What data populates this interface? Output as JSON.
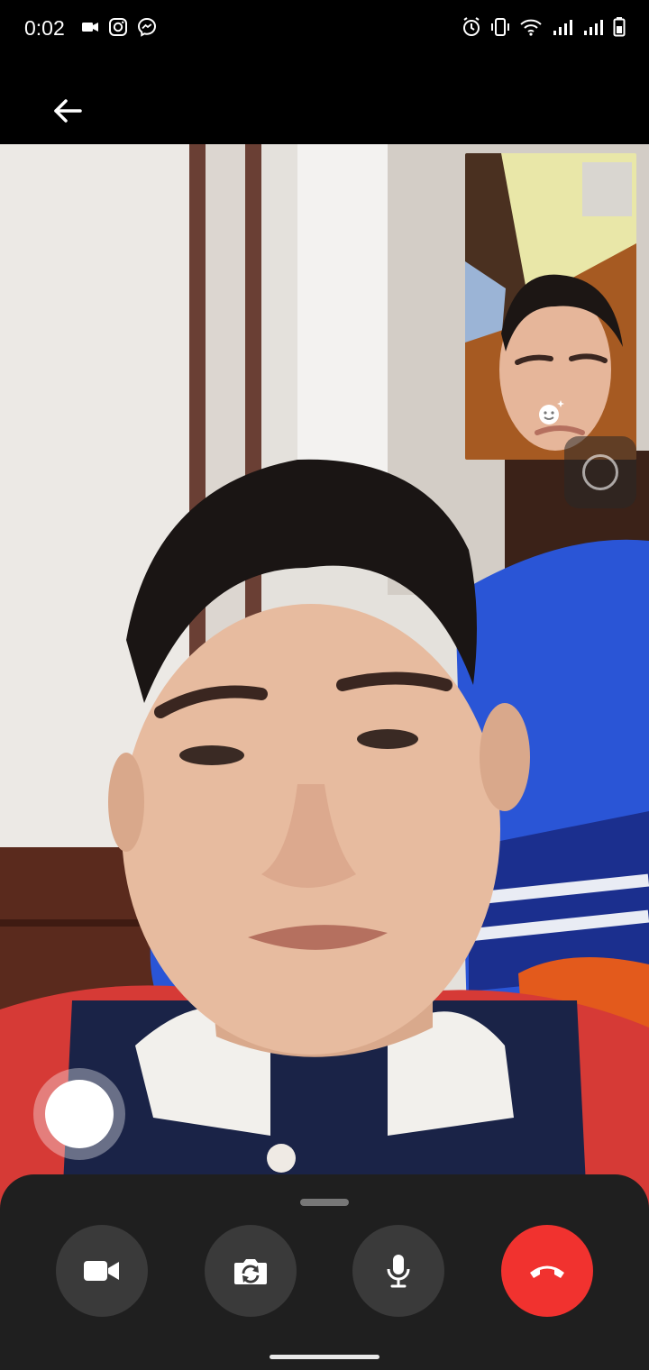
{
  "status_bar": {
    "time": "0:02",
    "left_icons": [
      "video-camera-icon",
      "instagram-icon",
      "messenger-icon"
    ],
    "right_icons": [
      "alarm-icon",
      "vibrate-icon",
      "wifi-icon",
      "signal-icon",
      "signal-icon",
      "battery-icon"
    ]
  },
  "header": {
    "back_icon": "back-arrow-icon"
  },
  "call": {
    "remote_video": "remote-participant-video",
    "self_preview": "self-camera-preview",
    "effects_icon": "effects-smiley-icon"
  },
  "controls": {
    "buttons": [
      {
        "name": "video-toggle",
        "icon": "video-camera-icon"
      },
      {
        "name": "flip-camera",
        "icon": "flip-camera-icon"
      },
      {
        "name": "mute-microphone",
        "icon": "microphone-icon"
      },
      {
        "name": "end-call",
        "icon": "hang-up-icon"
      }
    ]
  },
  "colors": {
    "end_call": "#f1322f",
    "control_bg": "#3a3a3a",
    "panel_bg": "#1f1f1f"
  }
}
